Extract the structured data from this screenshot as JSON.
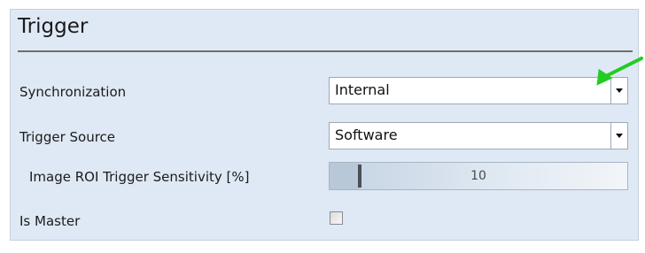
{
  "section": {
    "title": "Trigger"
  },
  "rows": {
    "synchronization": {
      "label": "Synchronization",
      "value": "Internal"
    },
    "trigger_source": {
      "label": "Trigger Source",
      "value": "Software"
    },
    "sensitivity": {
      "label": "Image ROI Trigger Sensitivity [%]",
      "value": "10",
      "fraction": 0.1
    },
    "is_master": {
      "label": "Is Master",
      "checked": false
    }
  },
  "annotation": {
    "icon": "green-arrow-icon",
    "color": "#22cc22"
  },
  "colors": {
    "panel_bg": "#dfe9f5",
    "header_rule": "#6f6f6f"
  }
}
